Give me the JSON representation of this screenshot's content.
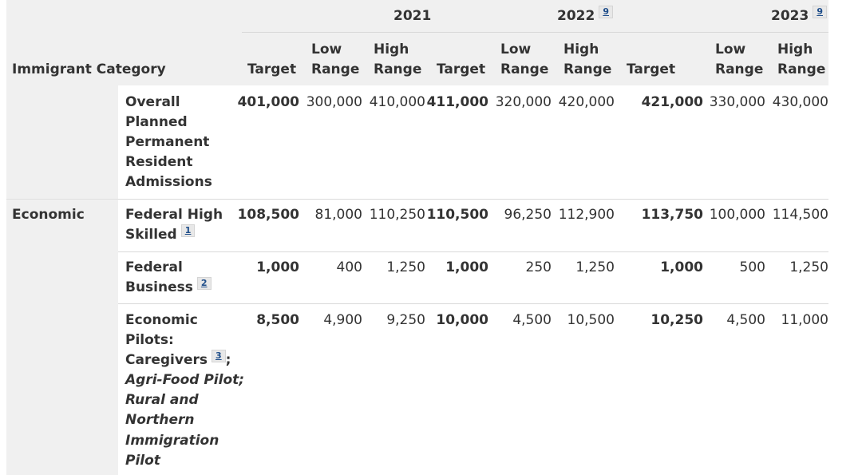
{
  "table": {
    "row_header_title": "Immigrant Category",
    "years": [
      {
        "label": "2021",
        "footnote": ""
      },
      {
        "label": "2022",
        "footnote": "9"
      },
      {
        "label": "2023",
        "footnote": "9"
      }
    ],
    "subheaders": {
      "target": "Target",
      "low_1": "Low",
      "low_2": "Range",
      "high_1": "High",
      "high_2": "Range"
    },
    "rows": [
      {
        "category": "",
        "label_lines": [
          "Overall",
          "Planned",
          "Permanent",
          "Resident",
          "Admissions"
        ],
        "values": [
          "401,000",
          "300,000",
          "410,000",
          "411,000",
          "320,000",
          "420,000",
          "421,000",
          "330,000",
          "430,000"
        ]
      },
      {
        "category": "Economic",
        "label_lines": [
          "Federal High",
          "Skilled"
        ],
        "footnote": "1",
        "values": [
          "108,500",
          "81,000",
          "110,250",
          "110,500",
          "96,250",
          "112,900",
          "113,750",
          "100,000",
          "114,500"
        ]
      },
      {
        "category": "",
        "label_lines": [
          "Federal",
          "Business"
        ],
        "footnote": "2",
        "values": [
          "1,000",
          "400",
          "1,250",
          "1,000",
          "250",
          "1,250",
          "1,000",
          "500",
          "1,250"
        ]
      },
      {
        "category": "",
        "label_lines": [
          "Economic",
          "Pilots:",
          "Caregivers"
        ],
        "footnote": "3",
        "trailing": ";",
        "italic_lines": [
          "Agri-Food Pilot;",
          "Rural and",
          "Northern",
          "Immigration",
          "Pilot"
        ],
        "values": [
          "8,500",
          "4,900",
          "9,250",
          "10,000",
          "4,500",
          "10,500",
          "10,250",
          "4,500",
          "11,000"
        ]
      }
    ]
  }
}
